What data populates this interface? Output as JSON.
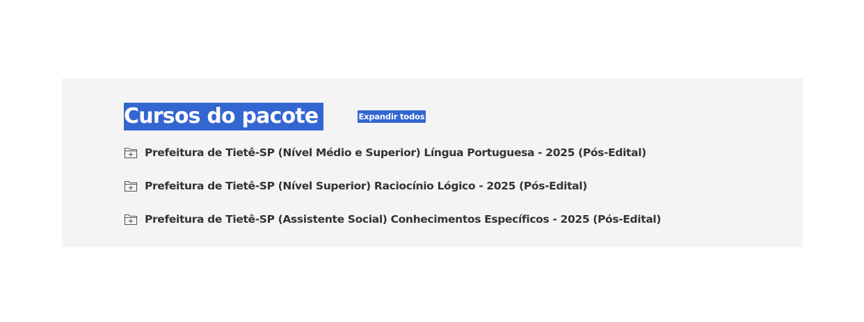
{
  "section": {
    "title": "Cursos do pacote",
    "expand_all_label": "Expandir todos"
  },
  "courses": [
    {
      "label": "Prefeitura de Tietê-SP (Nível Médio e Superior) Língua Portuguesa - 2025 (Pós-Edital)",
      "icon": "folder-plus-icon"
    },
    {
      "label": "Prefeitura de Tietê-SP (Nível Superior) Raciocínio Lógico - 2025 (Pós-Edital)",
      "icon": "folder-plus-icon"
    },
    {
      "label": "Prefeitura de Tietê-SP (Assistente Social) Conhecimentos Específicos - 2025 (Pós-Edital)",
      "icon": "folder-plus-icon"
    }
  ],
  "colors": {
    "accent": "#3466d1",
    "panel_background": "#f4f4f4",
    "text": "#333333"
  }
}
